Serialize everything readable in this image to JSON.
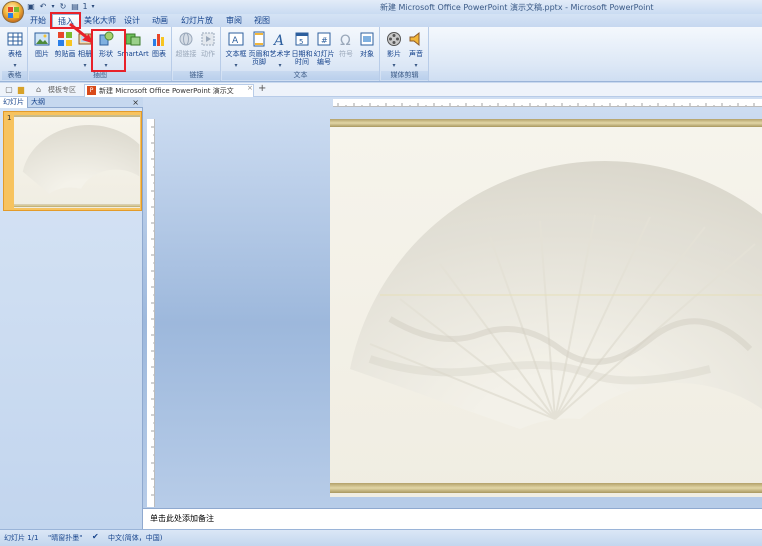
{
  "window": {
    "title": "新建 Microsoft Office PowerPoint 演示文稿.pptx - Microsoft PowerPoint",
    "qat_undo_count": "1"
  },
  "tabs": [
    {
      "label": "开始"
    },
    {
      "label": "插入"
    },
    {
      "label": "美化大师"
    },
    {
      "label": "设计"
    },
    {
      "label": "动画"
    },
    {
      "label": "幻灯片放映"
    },
    {
      "label": "审阅"
    },
    {
      "label": "视图"
    }
  ],
  "active_tab": "插入",
  "ribbon": {
    "groups": {
      "table": "表格",
      "illustrations": "插图",
      "links": "链接",
      "text": "文本",
      "media": "媒体剪辑"
    },
    "buttons": {
      "table": "表格",
      "picture": "图片",
      "clipart": "剪贴画",
      "album": "相册",
      "shapes": "形状",
      "smartart": "SmartArt",
      "chart": "图表",
      "hyperlink": "超链接",
      "action": "动作",
      "textbox": "文本框",
      "header_footer_1": "页眉和",
      "header_footer_2": "页脚",
      "wordart": "艺术字",
      "datetime_1": "日期和",
      "datetime_2": "时间",
      "slidenum_1": "幻灯片",
      "slidenum_2": "编号",
      "symbol": "符号",
      "object": "对象",
      "movie": "影片",
      "sound": "声音"
    }
  },
  "doc_tabs": {
    "template": "模板专区",
    "document": "新建 Microsoft Office PowerPoint 演示文稿.pptx",
    "add": "+"
  },
  "pane": {
    "tabs": [
      "幻灯片",
      "大纲"
    ],
    "close": "×",
    "slide_number": "1"
  },
  "notes": {
    "placeholder": "单击此处添加备注"
  },
  "status": {
    "slide": "幻灯片 1/1",
    "theme": "\"晴窗扑墨\"",
    "language": "中文(简体，中国)"
  },
  "colors": {
    "highlight": "#e8212a",
    "ribbon_text": "#15428b",
    "thumb_selected": "#f7c35f"
  }
}
